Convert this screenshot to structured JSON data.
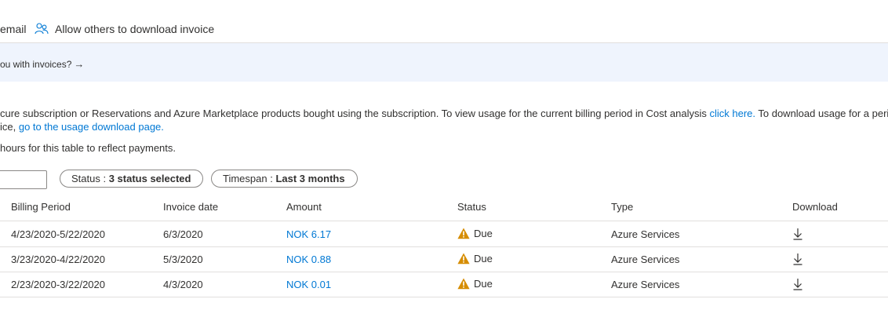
{
  "commandbar": {
    "email_label": "email",
    "allow_label": "Allow others to download invoice",
    "allow_icon": "people-icon"
  },
  "banner": {
    "text": "ou with invoices?",
    "arrow": "→",
    "background": "#eff4fd"
  },
  "description": {
    "line1_text": "cure subscription or Reservations and Azure Marketplace products bought using the subscription. To view usage for the current billing period in Cost analysis ",
    "line1_link": "click here.",
    "line1_tail": " To download usage for a perio",
    "line2_text": "ice, ",
    "line2_link": "go to the usage download page.",
    "line3_text": " hours for this table to reflect payments."
  },
  "filters": {
    "status_label": "Status : ",
    "status_value": "3 status selected",
    "timespan_label": "Timespan : ",
    "timespan_value": "Last 3 months"
  },
  "table": {
    "columns": [
      "Billing Period",
      "Invoice date",
      "Amount",
      "Status",
      "Type",
      "Download"
    ],
    "rows": [
      {
        "period": "4/23/2020-5/22/2020",
        "date": "6/3/2020",
        "amount": "NOK 6.17",
        "status": "Due",
        "type": "Azure Services"
      },
      {
        "period": "3/23/2020-4/22/2020",
        "date": "5/3/2020",
        "amount": "NOK 0.88",
        "status": "Due",
        "type": "Azure Services"
      },
      {
        "period": "2/23/2020-3/22/2020",
        "date": "4/3/2020",
        "amount": "NOK 0.01",
        "status": "Due",
        "type": "Azure Services"
      }
    ]
  },
  "colors": {
    "link": "#0078d4",
    "warning": "#d68d00",
    "text": "#323130",
    "divider": "#e1dfdd"
  },
  "icons": {
    "status_icon": "warning-icon",
    "download_icon": "download-icon"
  }
}
